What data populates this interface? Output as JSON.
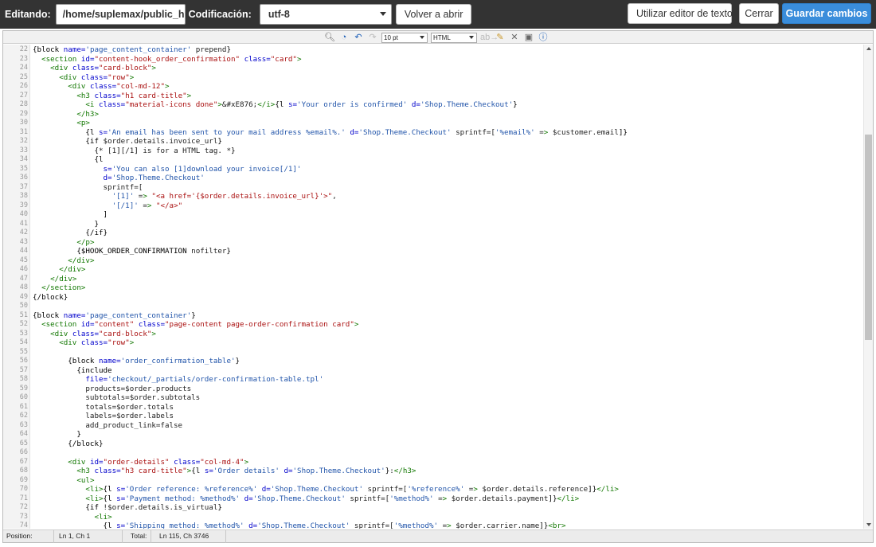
{
  "header": {
    "editing_label": "Editando:",
    "file_path": "/home/suplemax/public_h",
    "encoding_label": "Codificación:",
    "encoding_value": "utf-8",
    "back_button": "Volver a abrir",
    "text_editor_button": "Utilizar editor de texto",
    "close_button": "Cerrar",
    "save_button": "Guardar cambios"
  },
  "toolbar": {
    "font_size": "10 pt",
    "syntax": "HTML"
  },
  "editor": {
    "lines": [
      {
        "n": "22",
        "t": "{block name='page_content_container' prepend}"
      },
      {
        "n": "23",
        "t": "  <section id=\"content-hook_order_confirmation\" class=\"card\">"
      },
      {
        "n": "24",
        "t": "    <div class=\"card-block\">"
      },
      {
        "n": "25",
        "t": "      <div class=\"row\">"
      },
      {
        "n": "26",
        "t": "        <div class=\"col-md-12\">"
      },
      {
        "n": "27",
        "t": "          <h3 class=\"h1 card-title\">"
      },
      {
        "n": "28",
        "t": "            <i class=\"material-icons done\">&#xE876;</i>{l s='Your order is confirmed' d='Shop.Theme.Checkout'}"
      },
      {
        "n": "29",
        "t": "          </h3>"
      },
      {
        "n": "30",
        "t": "          <p>"
      },
      {
        "n": "31",
        "t": "            {l s='An email has been sent to your mail address %email%.' d='Shop.Theme.Checkout' sprintf=['%email%' => $customer.email]}"
      },
      {
        "n": "32",
        "t": "            {if $order.details.invoice_url}"
      },
      {
        "n": "33",
        "t": "              {* [1][/1] is for a HTML tag. *}"
      },
      {
        "n": "34",
        "t": "              {l"
      },
      {
        "n": "35",
        "t": "                s='You can also [1]download your invoice[/1]'"
      },
      {
        "n": "36",
        "t": "                d='Shop.Theme.Checkout'"
      },
      {
        "n": "37",
        "t": "                sprintf=["
      },
      {
        "n": "38",
        "t": "                  '[1]' => \"<a href='{$order.details.invoice_url}'>\","
      },
      {
        "n": "39",
        "t": "                  '[/1]' => \"</a>\""
      },
      {
        "n": "40",
        "t": "                ]"
      },
      {
        "n": "41",
        "t": "              }"
      },
      {
        "n": "42",
        "t": "            {/if}"
      },
      {
        "n": "43",
        "t": "          </p>"
      },
      {
        "n": "44",
        "t": "          {$HOOK_ORDER_CONFIRMATION nofilter}"
      },
      {
        "n": "45",
        "t": "        </div>"
      },
      {
        "n": "46",
        "t": "      </div>"
      },
      {
        "n": "47",
        "t": "    </div>"
      },
      {
        "n": "48",
        "t": "  </section>"
      },
      {
        "n": "49",
        "t": "{/block}"
      },
      {
        "n": "50",
        "t": ""
      },
      {
        "n": "51",
        "t": "{block name='page_content_container'}"
      },
      {
        "n": "52",
        "t": "  <section id=\"content\" class=\"page-content page-order-confirmation card\">"
      },
      {
        "n": "53",
        "t": "    <div class=\"card-block\">"
      },
      {
        "n": "54",
        "t": "      <div class=\"row\">"
      },
      {
        "n": "55",
        "t": ""
      },
      {
        "n": "56",
        "t": "        {block name='order_confirmation_table'}"
      },
      {
        "n": "57",
        "t": "          {include"
      },
      {
        "n": "58",
        "t": "            file='checkout/_partials/order-confirmation-table.tpl'"
      },
      {
        "n": "59",
        "t": "            products=$order.products"
      },
      {
        "n": "60",
        "t": "            subtotals=$order.subtotals"
      },
      {
        "n": "61",
        "t": "            totals=$order.totals"
      },
      {
        "n": "62",
        "t": "            labels=$order.labels"
      },
      {
        "n": "63",
        "t": "            add_product_link=false"
      },
      {
        "n": "64",
        "t": "          }"
      },
      {
        "n": "65",
        "t": "        {/block}"
      },
      {
        "n": "66",
        "t": ""
      },
      {
        "n": "67",
        "t": "        <div id=\"order-details\" class=\"col-md-4\">"
      },
      {
        "n": "68",
        "t": "          <h3 class=\"h3 card-title\">{l s='Order details' d='Shop.Theme.Checkout'}:</h3>"
      },
      {
        "n": "69",
        "t": "          <ul>"
      },
      {
        "n": "70",
        "t": "            <li>{l s='Order reference: %reference%' d='Shop.Theme.Checkout' sprintf=['%reference%' => $order.details.reference]}</li>"
      },
      {
        "n": "71",
        "t": "            <li>{l s='Payment method: %method%' d='Shop.Theme.Checkout' sprintf=['%method%' => $order.details.payment]}</li>"
      },
      {
        "n": "72",
        "t": "            {if !$order.details.is_virtual}"
      },
      {
        "n": "73",
        "t": "              <li>"
      },
      {
        "n": "74",
        "t": "                {l s='Shipping method: %method%' d='Shop.Theme.Checkout' sprintf=['%method%' => $order.carrier.name]}<br>"
      }
    ]
  },
  "status": {
    "position_label": "Position:",
    "position_value": "Ln 1, Ch 1",
    "total_label": "Total:",
    "total_value": "Ln 115, Ch 3746"
  },
  "colors": {
    "tag": "#117700",
    "attr": "#0000cc",
    "string": "#aa1111",
    "smarty": "#000000",
    "smarty_string": "#2255aa",
    "smarty_attr": "#0000cc"
  }
}
